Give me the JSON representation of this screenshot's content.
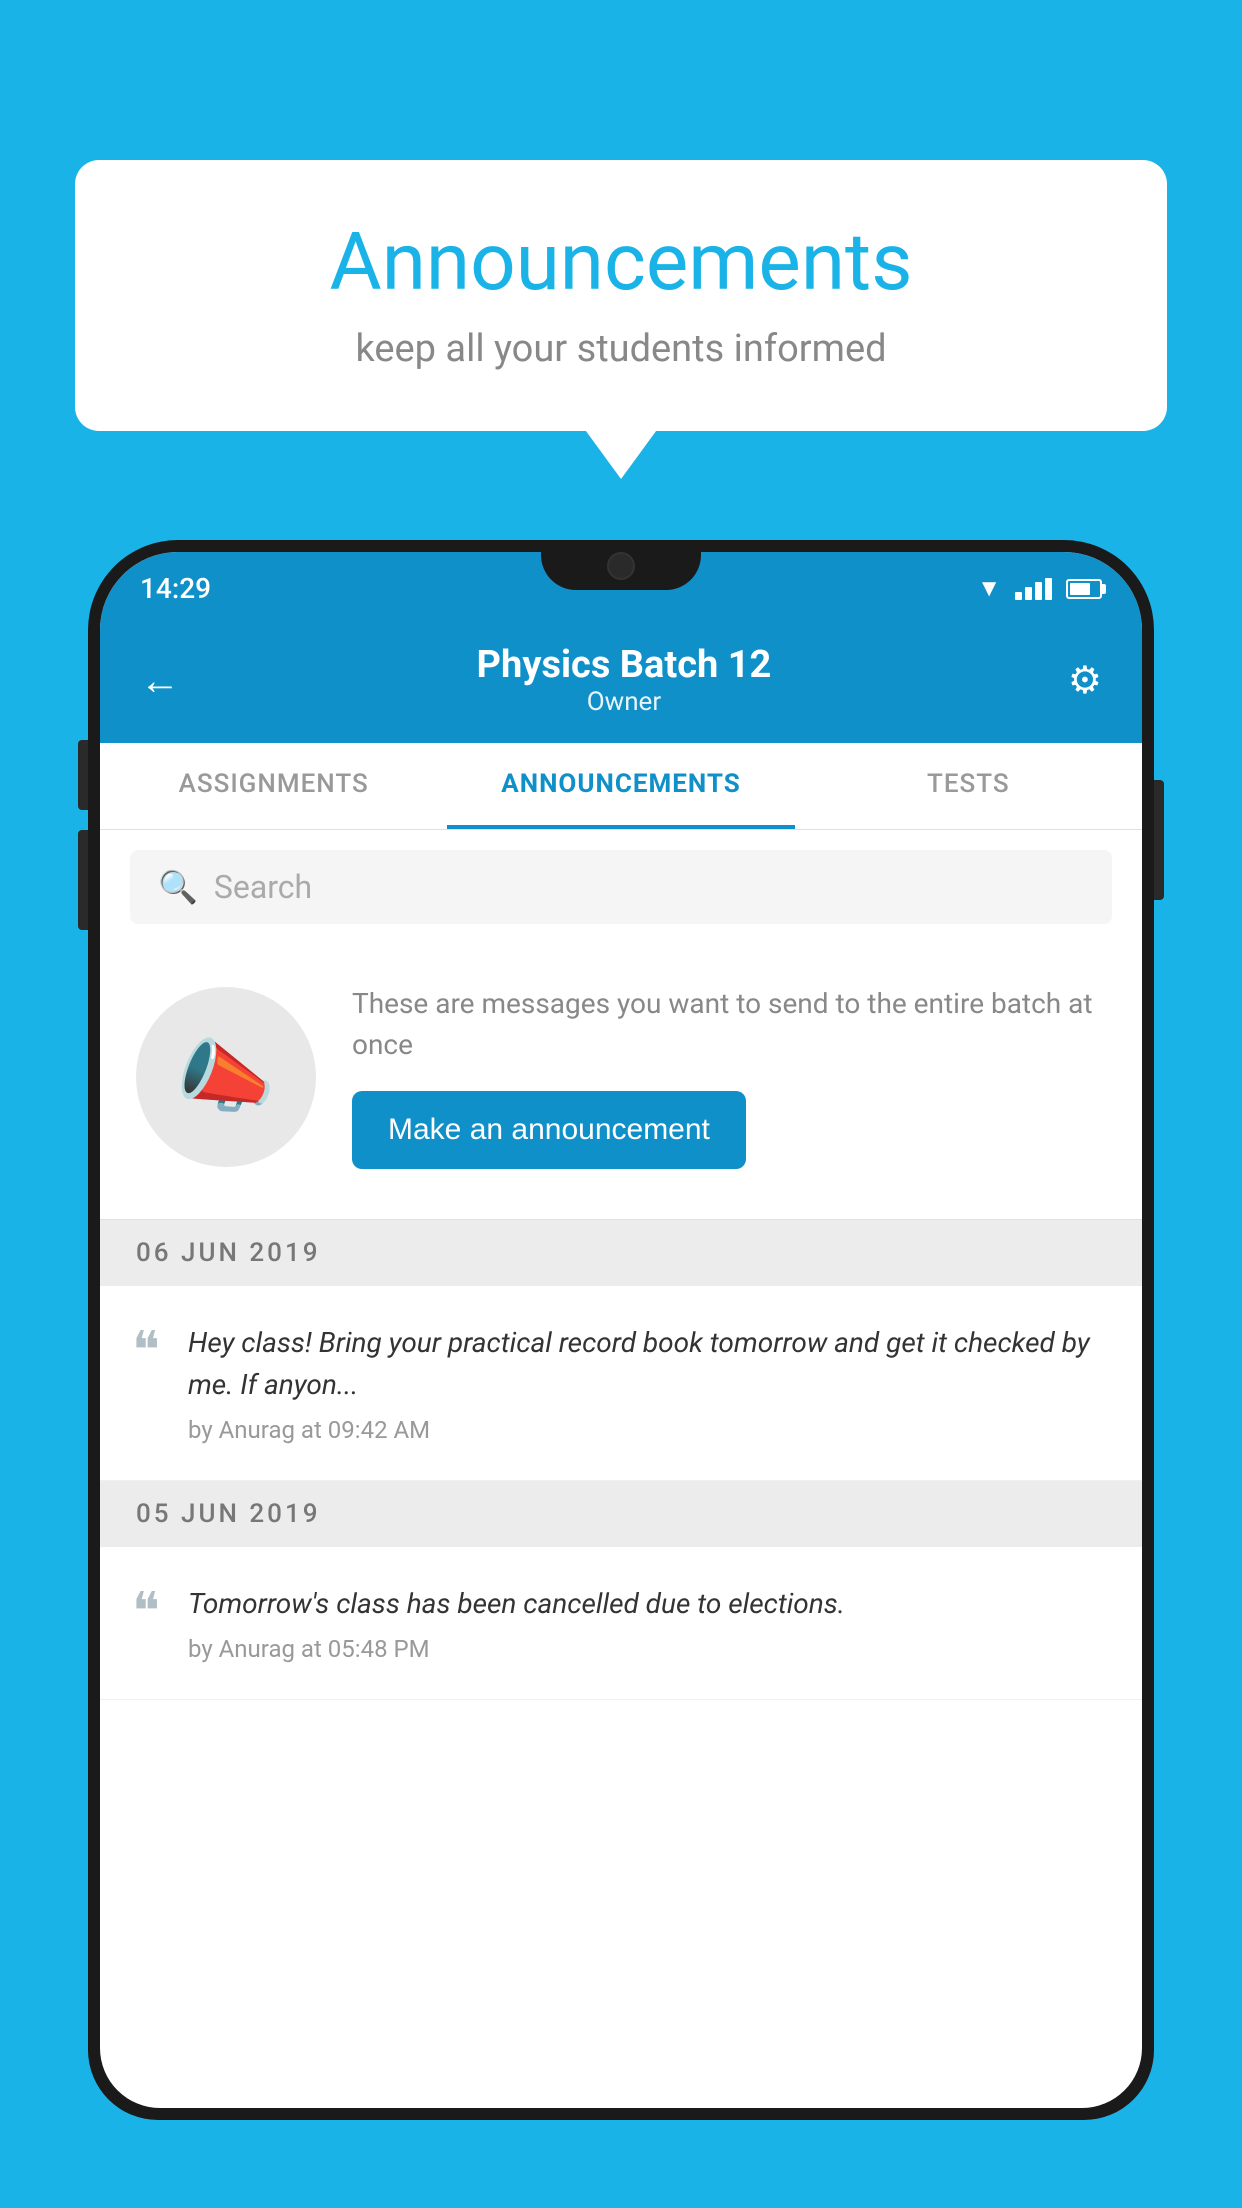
{
  "background_color": "#1ab3e8",
  "speech_bubble": {
    "title": "Announcements",
    "subtitle": "keep all your students informed"
  },
  "phone": {
    "status_bar": {
      "time": "14:29"
    },
    "header": {
      "title": "Physics Batch 12",
      "subtitle": "Owner",
      "back_label": "←",
      "settings_label": "⚙"
    },
    "tabs": [
      {
        "label": "ASSIGNMENTS",
        "active": false
      },
      {
        "label": "ANNOUNCEMENTS",
        "active": true
      },
      {
        "label": "TESTS",
        "active": false
      }
    ],
    "search": {
      "placeholder": "Search"
    },
    "promo": {
      "description": "These are messages you want to send to the entire batch at once",
      "button_label": "Make an announcement"
    },
    "announcements": [
      {
        "date": "06  JUN  2019",
        "text": "Hey class! Bring your practical record book tomorrow and get it checked by me. If anyon...",
        "meta": "by Anurag at 09:42 AM"
      },
      {
        "date": "05  JUN  2019",
        "text": "Tomorrow's class has been cancelled due to elections.",
        "meta": "by Anurag at 05:48 PM"
      }
    ]
  }
}
